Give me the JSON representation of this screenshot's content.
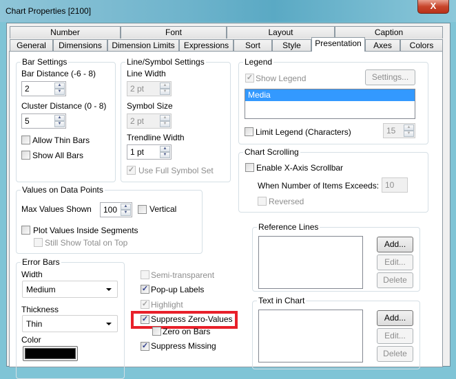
{
  "window": {
    "title": "Chart Properties [2100]",
    "close": "X"
  },
  "tabs_row1": [
    "Number",
    "Font",
    "Layout",
    "Caption"
  ],
  "tabs_row2": [
    "General",
    "Dimensions",
    "Dimension Limits",
    "Expressions",
    "Sort",
    "Style",
    "Presentation",
    "Axes",
    "Colors"
  ],
  "active_tab": "Presentation",
  "bar_settings": {
    "title": "Bar Settings",
    "bar_distance_label": "Bar Distance (-6 - 8)",
    "bar_distance": "2",
    "cluster_distance_label": "Cluster Distance (0 - 8)",
    "cluster_distance": "5",
    "allow_thin_bars": "Allow Thin Bars",
    "show_all_bars": "Show All Bars"
  },
  "line_symbol": {
    "title": "Line/Symbol Settings",
    "line_width_label": "Line Width",
    "line_width": "2 pt",
    "symbol_size_label": "Symbol Size",
    "symbol_size": "2 pt",
    "trendline_width_label": "Trendline Width",
    "trendline_width": "1 pt",
    "use_full_symbol_set": "Use Full Symbol Set"
  },
  "values_on_points": {
    "title": "Values on Data Points",
    "max_values_label": "Max Values Shown",
    "max_values": "100",
    "vertical": "Vertical",
    "plot_inside": "Plot Values Inside Segments",
    "still_show_total": "Still Show Total on Top"
  },
  "error_bars": {
    "title": "Error Bars",
    "width_label": "Width",
    "width": "Medium",
    "thickness_label": "Thickness",
    "thickness": "Thin",
    "color_label": "Color",
    "color": "#000000"
  },
  "options": {
    "semi_transparent": "Semi-transparent",
    "popup_labels": "Pop-up Labels",
    "highlight": "Highlight",
    "suppress_zero": "Suppress Zero-Values",
    "zero_on_bars": "Zero on Bars",
    "suppress_missing": "Suppress Missing",
    "highlight_box_color": "#e8202a"
  },
  "legend": {
    "title": "Legend",
    "show_legend": "Show Legend",
    "settings": "Settings...",
    "items": [
      "Media"
    ],
    "limit_legend": "Limit Legend (Characters)",
    "limit_value": "15"
  },
  "chart_scrolling": {
    "title": "Chart Scrolling",
    "enable": "Enable X-Axis Scrollbar",
    "exceeds_label": "When Number of Items Exceeds:",
    "exceeds_value": "10",
    "reversed": "Reversed"
  },
  "reference_lines": {
    "title": "Reference Lines",
    "add": "Add...",
    "edit": "Edit...",
    "delete": "Delete"
  },
  "text_in_chart": {
    "title": "Text in Chart",
    "add": "Add...",
    "edit": "Edit...",
    "delete": "Delete"
  },
  "check": "✓"
}
